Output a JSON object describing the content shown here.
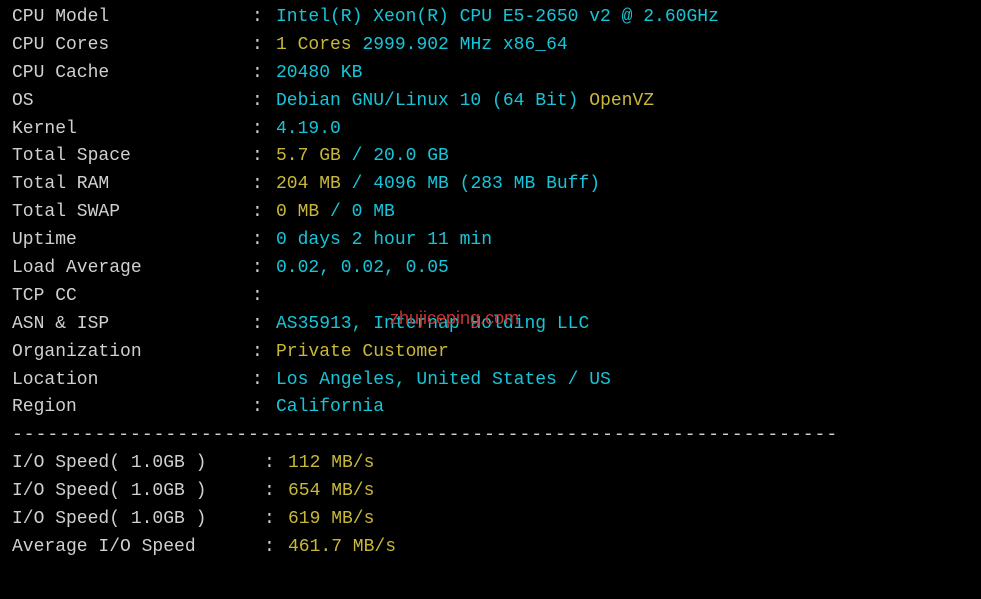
{
  "sysinfo": {
    "cpu_model": {
      "label": "CPU Model",
      "value": "Intel(R) Xeon(R) CPU E5-2650 v2 @ 2.60GHz"
    },
    "cpu_cores": {
      "label": "CPU Cores",
      "count": "1 Cores",
      "freq": "2999.902 MHz x86_64"
    },
    "cpu_cache": {
      "label": "CPU Cache",
      "value": "20480 KB"
    },
    "os": {
      "label": "OS",
      "name": "Debian GNU/Linux 10 (64 Bit)",
      "virt": "OpenVZ"
    },
    "kernel": {
      "label": "Kernel",
      "value": "4.19.0"
    },
    "total_space": {
      "label": "Total Space",
      "used": "5.7 GB",
      "total": "20.0 GB"
    },
    "total_ram": {
      "label": "Total RAM",
      "used": "204 MB",
      "total": "4096 MB",
      "buff": "(283 MB Buff)"
    },
    "total_swap": {
      "label": "Total SWAP",
      "used": "0 MB",
      "total": "0 MB"
    },
    "uptime": {
      "label": "Uptime",
      "value": "0 days 2 hour 11 min"
    },
    "load_avg": {
      "label": "Load Average",
      "value": "0.02, 0.02, 0.05"
    },
    "tcp_cc": {
      "label": "TCP CC",
      "value": ""
    },
    "asn_isp": {
      "label": "ASN & ISP",
      "value": "AS35913, Internap Holding LLC"
    },
    "organization": {
      "label": "Organization",
      "value": "Private Customer"
    },
    "location": {
      "label": "Location",
      "value": "Los Angeles, United States / US"
    },
    "region": {
      "label": "Region",
      "value": "California"
    }
  },
  "io": {
    "tests": [
      {
        "label": "I/O Speed( 1.0GB )",
        "value": "112 MB/s"
      },
      {
        "label": "I/O Speed( 1.0GB )",
        "value": "654 MB/s"
      },
      {
        "label": "I/O Speed( 1.0GB )",
        "value": "619 MB/s"
      }
    ],
    "average": {
      "label": "Average I/O Speed",
      "value": "461.7 MB/s"
    }
  },
  "watermark": "zhujiceping.com",
  "divider": "----------------------------------------------------------------------"
}
